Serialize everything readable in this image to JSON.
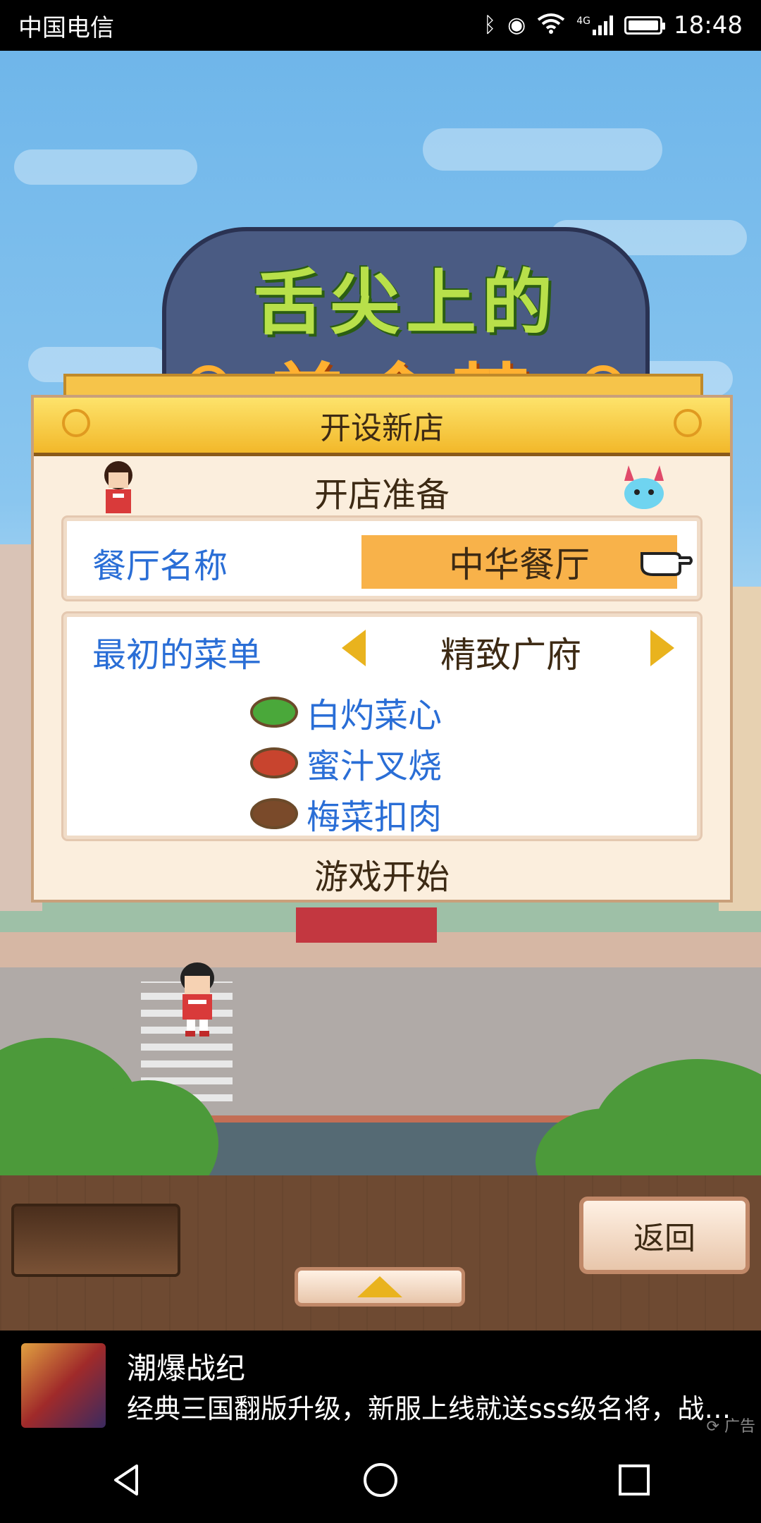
{
  "status_bar": {
    "carrier": "中国电信",
    "network": "4G",
    "time": "18:48"
  },
  "game": {
    "title_line1": "舌尖上的",
    "title_line2": "美食梦"
  },
  "dialog": {
    "header": "开设新店",
    "section_title": "开店准备",
    "restaurant_name_label": "餐厅名称",
    "restaurant_name_value": "中华餐厅",
    "menu_label": "最初的菜单",
    "menu_selected": "精致广府",
    "dishes": [
      "白灼菜心",
      "蜜汁叉烧",
      "梅菜扣肉"
    ],
    "start_label": "游戏开始"
  },
  "bottom_bar": {
    "back_label": "返回"
  },
  "ad": {
    "title": "潮爆战纪",
    "description": "经典三国翻版升级，新服上线就送sss级名将，战…",
    "tag": "广告"
  },
  "colors": {
    "accent_blue": "#2a6ed6",
    "header_yellow": "#f2b82a",
    "name_field_orange": "#f8b24a"
  }
}
